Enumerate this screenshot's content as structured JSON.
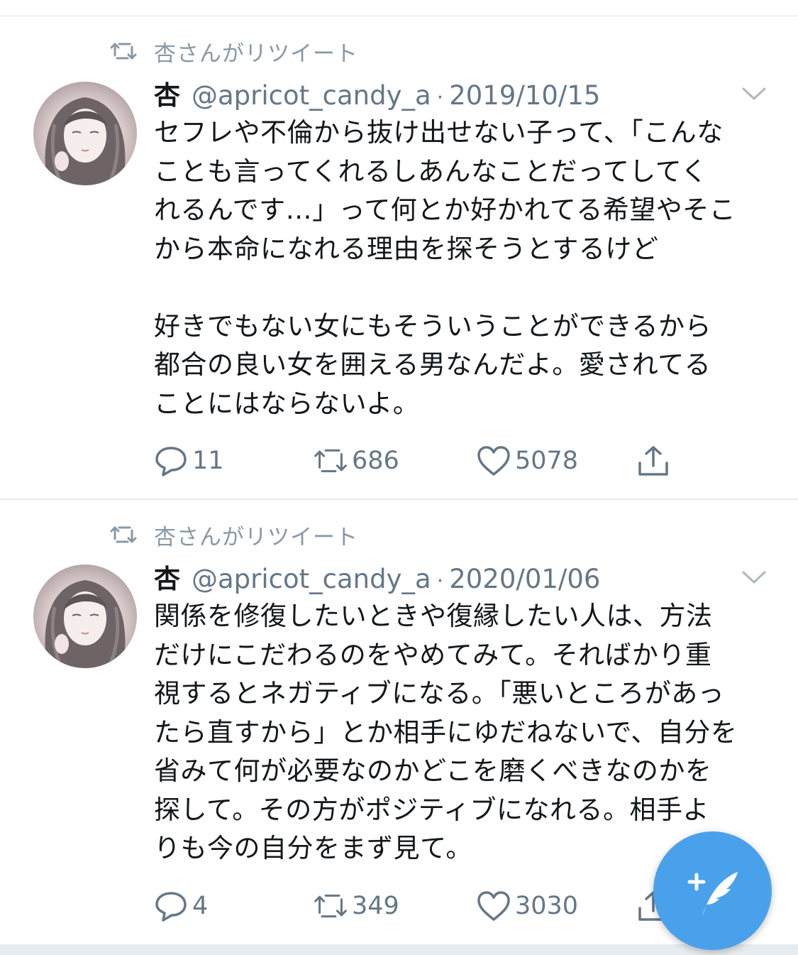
{
  "colors": {
    "accent": "#4aa1eb",
    "secondary_text": "#657786",
    "retweet_label": "#8899a6",
    "divider": "#e6ecf0"
  },
  "tweets": [
    {
      "retweeted_by": "杏さんがリツイート",
      "author_name": "杏",
      "handle": "@apricot_candy_a",
      "separator": "·",
      "date": "2019/10/15",
      "text": "セフレや不倫から抜け出せない子って、「こんな\nことも言ってくれるしあんなことだってしてく\nれるんです…」って何とか好かれてる希望やそこ\nから本命になれる理由を探そうとするけど\n\n好きでもない女にもそういうことができるから\n都合の良い女を囲える男なんだよ。愛されてる\nことにはならないよ。",
      "replies": "11",
      "retweets": "686",
      "likes": "5078",
      "icons": [
        "retweet-icon",
        "avatar",
        "chevron-down-icon",
        "reply-icon",
        "retweet-icon",
        "like-icon",
        "share-icon"
      ]
    },
    {
      "retweeted_by": "杏さんがリツイート",
      "author_name": "杏",
      "handle": "@apricot_candy_a",
      "separator": "·",
      "date": "2020/01/06",
      "text": "関係を修復したいときや復縁したい人は、方法\nだけにこだわるのをやめてみて。そればかり重\n視するとネガティブになる。「悪いところがあっ\nたら直すから」とか相手にゆだねないで、自分を\n省みて何が必要なのかどこを磨くべきなのかを\n探して。その方がポジティブになれる。相手よ\nりも今の自分をまず見て。",
      "replies": "4",
      "retweets": "349",
      "likes": "3030",
      "icons": [
        "retweet-icon",
        "avatar",
        "chevron-down-icon",
        "reply-icon",
        "retweet-icon",
        "like-icon",
        "share-icon"
      ]
    }
  ],
  "fab": {
    "icon": "compose-tweet-icon"
  }
}
